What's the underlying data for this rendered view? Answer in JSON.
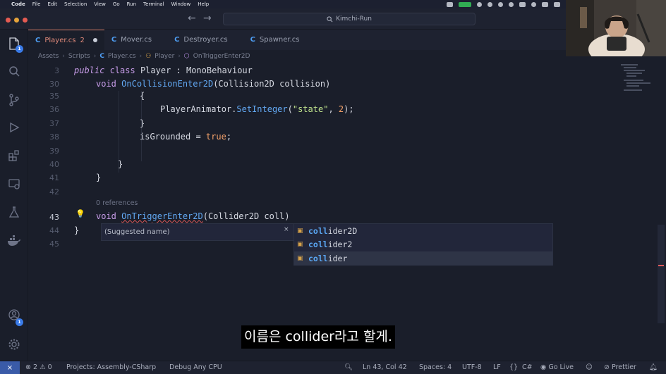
{
  "menubar": {
    "app_name": "Code",
    "items": [
      "File",
      "Edit",
      "Selection",
      "View",
      "Go",
      "Run",
      "Terminal",
      "Window",
      "Help"
    ]
  },
  "titlebar": {
    "search_text": "Kimchi-Run"
  },
  "activity": {
    "explorer_badge": "1",
    "accounts_badge": "1"
  },
  "tabs": [
    {
      "label": "Player.cs",
      "extra": "2",
      "modified": true
    },
    {
      "label": "Mover.cs"
    },
    {
      "label": "Destroyer.cs"
    },
    {
      "label": "Spawner.cs"
    }
  ],
  "breadcrumb": [
    "Assets",
    "Scripts",
    "Player.cs",
    "Player",
    "OnTriggerEnter2D"
  ],
  "lines": {
    "l3": "3",
    "l30": "30",
    "l35": "35",
    "l36": "36",
    "l37": "37",
    "l38": "38",
    "l39": "39",
    "l40": "40",
    "l41": "41",
    "l42": "42",
    "l43": "43",
    "l44": "44",
    "l45": "45"
  },
  "code": {
    "public": "public",
    "class": "class",
    "player_decl": " Player : MonoBehaviour",
    "void": "void",
    "on_collision": "OnCollisionEnter2D",
    "collision_params": "(Collision2D collision)",
    "brace_open": "{",
    "brace_close": "}",
    "animator": "PlayerAnimator.",
    "set_integer": "SetInteger",
    "paren_open": "(",
    "state_str": "\"state\"",
    "comma": ", ",
    "two": "2",
    "paren_close_semi": ");",
    "is_grounded": "isGrounded = ",
    "true": "true",
    "semi": ";",
    "references": "0 references",
    "on_trigger": "OnTriggerEnter2D",
    "trigger_params": "(Collider2D coll)"
  },
  "rename": {
    "placeholder": "(Suggested name)",
    "close": "×"
  },
  "suggestions": [
    {
      "match": "coll",
      "rest": "ider2D"
    },
    {
      "match": "coll",
      "rest": "ider2"
    },
    {
      "match": "coll",
      "rest": "ider"
    }
  ],
  "status": {
    "errors": "2",
    "warnings": "0",
    "project": "Projects: Assembly-CSharp",
    "debug": "Debug Any CPU",
    "position": "Ln 43, Col 42",
    "spaces": "Spaces: 4",
    "encoding": "UTF-8",
    "eol": "LF",
    "language": "C#",
    "golive": "Go Live",
    "prettier": "Prettier"
  },
  "subtitle": "이름은 collider라고 할게."
}
